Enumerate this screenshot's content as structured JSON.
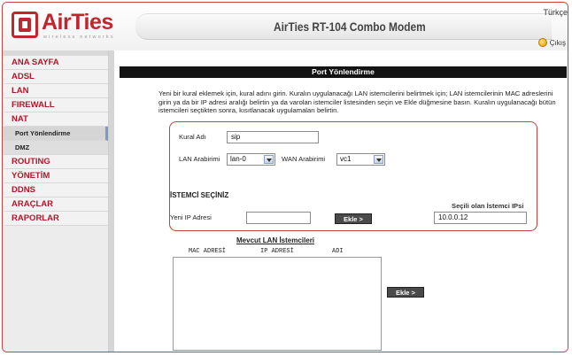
{
  "header": {
    "logo_text": "AirTies",
    "logo_sub": "wireless networks",
    "model_title": "AirTies RT-104 Combo Modem",
    "language": "Türkçe",
    "exit_label": "Çıkış"
  },
  "sidebar": {
    "items": [
      {
        "label": "ANA SAYFA"
      },
      {
        "label": "ADSL"
      },
      {
        "label": "LAN"
      },
      {
        "label": "FIREWALL"
      },
      {
        "label": "NAT"
      },
      {
        "label": "Port Yönlendirme"
      },
      {
        "label": "DMZ"
      },
      {
        "label": "ROUTING"
      },
      {
        "label": "YÖNETİM"
      },
      {
        "label": "DDNS"
      },
      {
        "label": "ARAÇLAR"
      },
      {
        "label": "RAPORLAR"
      }
    ]
  },
  "main": {
    "section_title": "Port Yönlendirme",
    "intro": "Yeni bir kural eklemek için, kural adını girin. Kuralın uygulanacağı LAN istemcilerini belirtmek için; LAN istemcilerinin MAC adreslerini girin ya da bir IP adresi aralığı belirtin ya da varolan istemciler listesinden seçin ve Ekle düğmesine basın. Kuralın uygulanacağı bütün istemcileri seçtikten sonra, kısıtlanacak uygulamaları belirtin.",
    "rule_name_label": "Kural Adı",
    "rule_name_value": "sip",
    "lan_interface_label": "LAN Arabirimi",
    "lan_interface_value": "lan-0",
    "wan_interface_label": "WAN Arabirimi",
    "wan_interface_value": "vc1",
    "client_select_title": "İSTEMCİ SEÇİNİZ",
    "new_ip_label": "Yeni IP Adresi",
    "new_ip_value": "",
    "add_button": "Ekle >",
    "selected_client_label": "Seçili olan İstemci IPsi",
    "selected_client_value": "10.0.0.12",
    "client_list_title": "Mevcut LAN İstemcileri",
    "columns": [
      "MAC ADRESİ",
      "IP ADRESİ",
      "ADI"
    ],
    "add_button2": "Ekle >"
  }
}
